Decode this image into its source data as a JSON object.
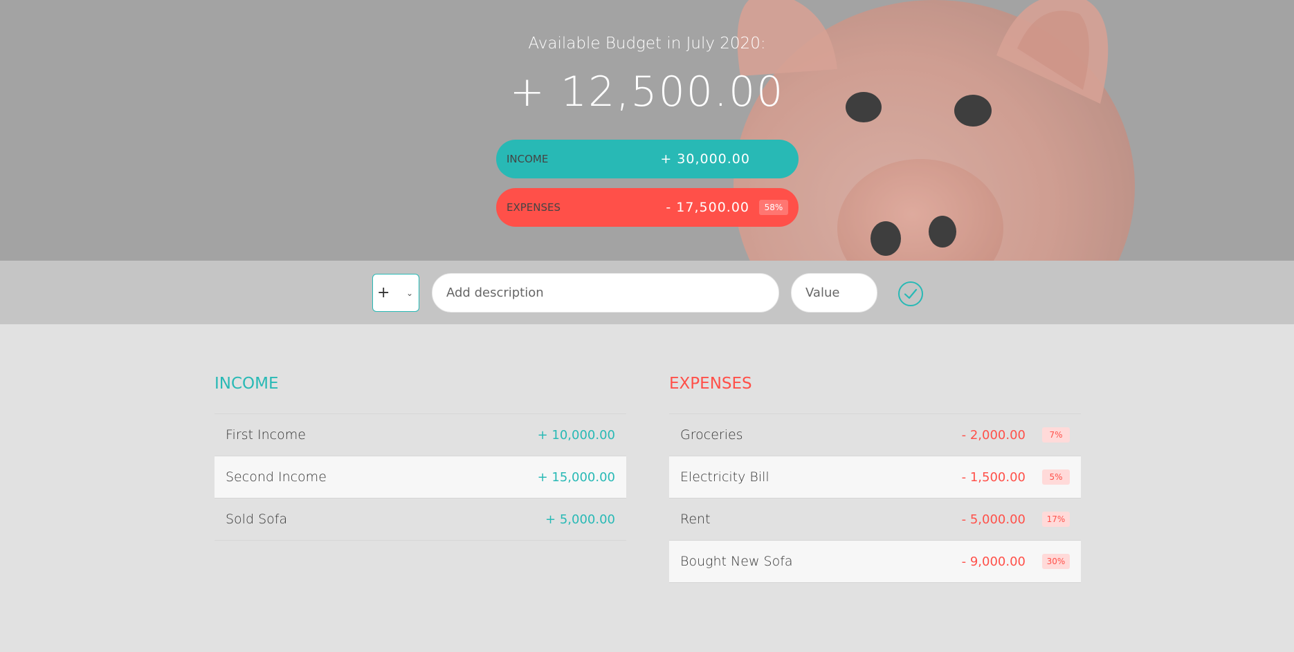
{
  "header": {
    "title": "Available Budget in July 2020:",
    "budget": "+ 12,500.00",
    "income_label": "Income",
    "income_value": "+ 30,000.00",
    "expenses_label": "Expenses",
    "expenses_value": "- 17,500.00",
    "expenses_percentage": "58%"
  },
  "add_bar": {
    "type_options": [
      "+",
      "-"
    ],
    "type_selected": "+",
    "description_placeholder": "Add description",
    "value_placeholder": "Value",
    "submit_icon": "check-circle-icon"
  },
  "income": {
    "title": "Income",
    "items": [
      {
        "description": "First Income",
        "value": "+ 10,000.00"
      },
      {
        "description": "Second Income",
        "value": "+ 15,000.00"
      },
      {
        "description": "Sold Sofa",
        "value": "+ 5,000.00"
      }
    ]
  },
  "expenses": {
    "title": "Expenses",
    "items": [
      {
        "description": "Groceries",
        "value": "- 2,000.00",
        "percentage": "7%"
      },
      {
        "description": "Electricity Bill",
        "value": "- 1,500.00",
        "percentage": "5%"
      },
      {
        "description": "Rent",
        "value": "- 5,000.00",
        "percentage": "17%"
      },
      {
        "description": "Bought New Sofa",
        "value": "- 9,000.00",
        "percentage": "30%"
      }
    ]
  },
  "colors": {
    "income": "#28b9b5",
    "expenses": "#ff5049"
  }
}
